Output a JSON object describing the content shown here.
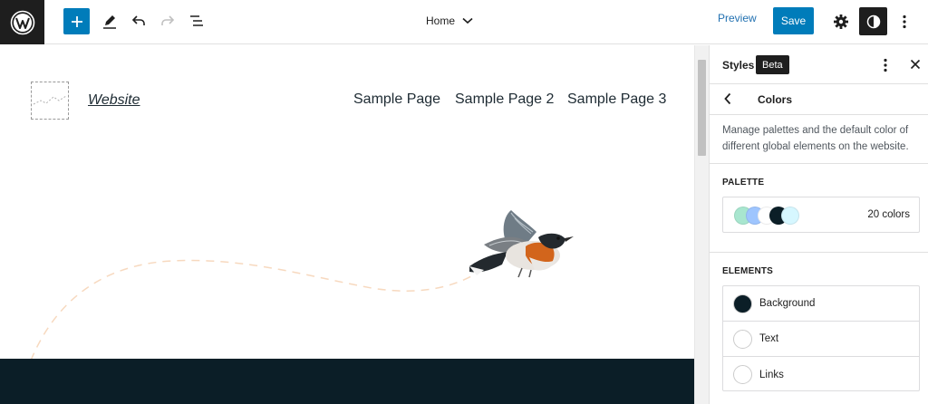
{
  "toolbar": {
    "document_title": "Home",
    "preview_label": "Preview",
    "save_label": "Save"
  },
  "canvas": {
    "site_title": "Website",
    "nav_items": [
      "Sample Page",
      "Sample Page 2",
      "Sample Page 3"
    ]
  },
  "sidebar": {
    "title": "Styles",
    "badge": "Beta",
    "panel_title": "Colors",
    "description": "Manage palettes and the default color of different global elements on the website.",
    "palette_label": "PALETTE",
    "palette_count": "20 colors",
    "palette_swatches": [
      "#a8e6cf",
      "#9ec5fe",
      "#ffffff",
      "#0b1e27",
      "#d6f7ff"
    ],
    "elements_label": "ELEMENTS",
    "elements": [
      {
        "label": "Background",
        "color": "#0b1e27"
      },
      {
        "label": "Text",
        "color": "#ffffff"
      },
      {
        "label": "Links",
        "color": "#ffffff"
      }
    ]
  },
  "colors": {
    "accent": "#007cba",
    "footer": "#0b1e27",
    "toolbar_dark": "#1e1e1e"
  }
}
